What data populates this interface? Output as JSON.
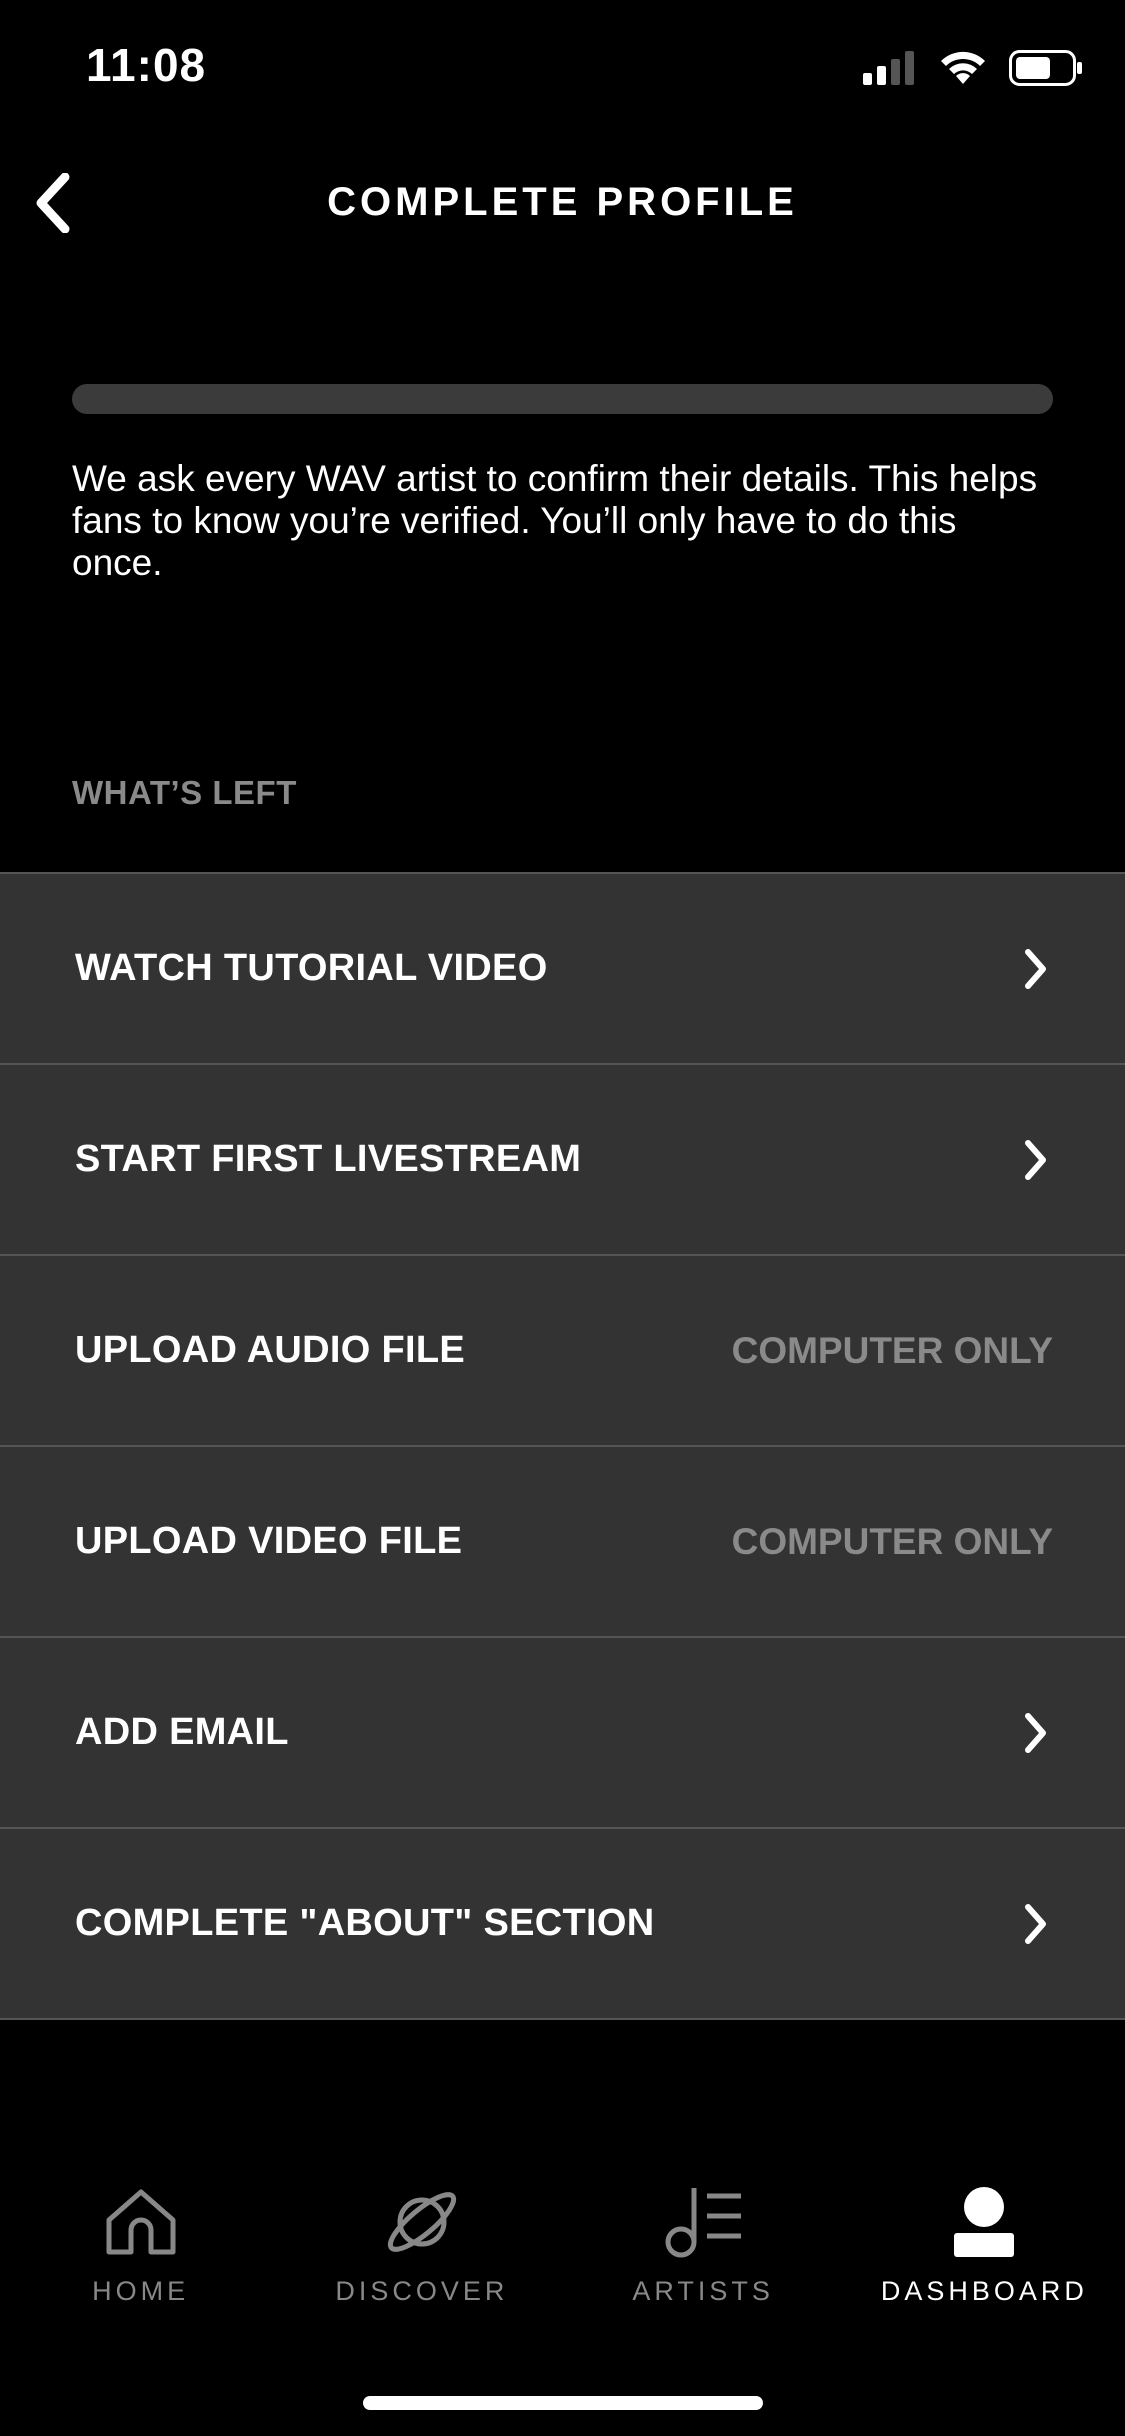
{
  "status_bar": {
    "time": "11:08"
  },
  "nav": {
    "title": "COMPLETE PROFILE"
  },
  "progress": {
    "fraction": 0.0
  },
  "intro": {
    "text": "We ask every WAV artist to confirm their details. This helps fans to know you’re verified. You’ll only have to do this once."
  },
  "section": {
    "label": "WHAT’S LEFT"
  },
  "tasks": [
    {
      "label": "WATCH TUTORIAL VIDEO",
      "right": "",
      "icon": "chevron-right-icon"
    },
    {
      "label": "START FIRST LIVESTREAM",
      "right": "",
      "icon": "chevron-right-icon"
    },
    {
      "label": "UPLOAD AUDIO FILE",
      "right": "COMPUTER ONLY"
    },
    {
      "label": "UPLOAD VIDEO FILE",
      "right": "COMPUTER ONLY"
    },
    {
      "label": "ADD EMAIL",
      "right": "",
      "icon": "chevron-right-icon"
    },
    {
      "label": "COMPLETE \"ABOUT\" SECTION",
      "right": "",
      "icon": "chevron-right-icon"
    }
  ],
  "tabbar": {
    "home": "HOME",
    "discover": "DISCOVER",
    "artists": "ARTISTS",
    "dashboard": "DASHBOARD",
    "active": "dashboard"
  },
  "colors": {
    "background": "#000000",
    "row": "#333333",
    "muted": "#8a8a8a",
    "divider": "#555555"
  }
}
